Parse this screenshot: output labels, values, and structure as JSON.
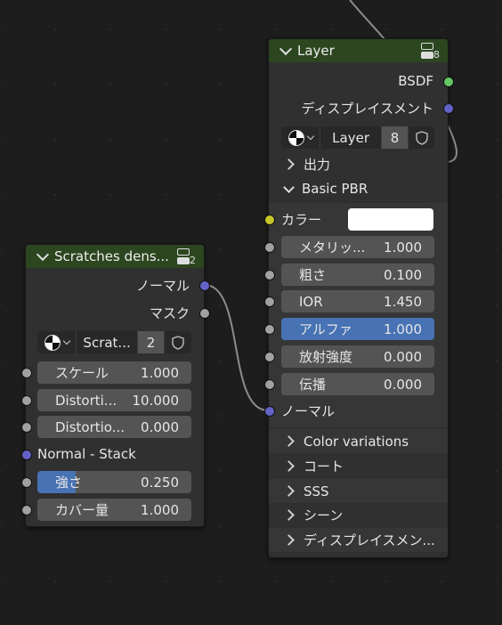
{
  "nodes": {
    "scratches": {
      "title": "Scratches dens...",
      "user_count": "2",
      "outputs": [
        "ノーマル",
        "マスク"
      ],
      "selector": {
        "name": "Scrat...",
        "users": "2"
      },
      "fields": [
        {
          "label": "スケール",
          "value": "1.000",
          "socket": "gray"
        },
        {
          "label": "Distorti...",
          "value": "10.000",
          "socket": "gray"
        },
        {
          "label": "Distortio...",
          "value": "0.000",
          "socket": "gray"
        }
      ],
      "normal_input": "Normal - Stack",
      "fields2": [
        {
          "label": "強さ",
          "value": "0.250",
          "fill": 0.25
        },
        {
          "label": "カバー量",
          "value": "1.000",
          "fill": 0
        }
      ]
    },
    "layer": {
      "title": "Layer",
      "user_count": "8",
      "outputs": [
        "BSDF",
        "ディスプレイスメント"
      ],
      "selector": {
        "name": "Layer",
        "users": "8"
      },
      "panels_top": [
        "出力",
        "Basic PBR"
      ],
      "color_label": "カラー",
      "color_value": "#ffffff",
      "fields": [
        {
          "label": "メタリッ...",
          "value": "1.000",
          "active": false
        },
        {
          "label": "粗さ",
          "value": "0.100",
          "active": false
        },
        {
          "label": "IOR",
          "value": "1.450",
          "active": false
        },
        {
          "label": "アルファ",
          "value": "1.000",
          "active": true
        },
        {
          "label": "放射強度",
          "value": "0.000",
          "active": false
        },
        {
          "label": "伝播",
          "value": "0.000",
          "active": false
        }
      ],
      "normal_input": "ノーマル",
      "panels_bottom": [
        "Color variations",
        "コート",
        "SSS",
        "シーン",
        "ディスプレイスメン..."
      ]
    }
  },
  "colors": {
    "header_green": "#2c4620",
    "socket_gray": "#a1a1a1",
    "socket_blue": "#6363c7",
    "socket_green": "#63c763",
    "socket_yellow": "#c7c729",
    "active_blue": "#4772b3"
  }
}
